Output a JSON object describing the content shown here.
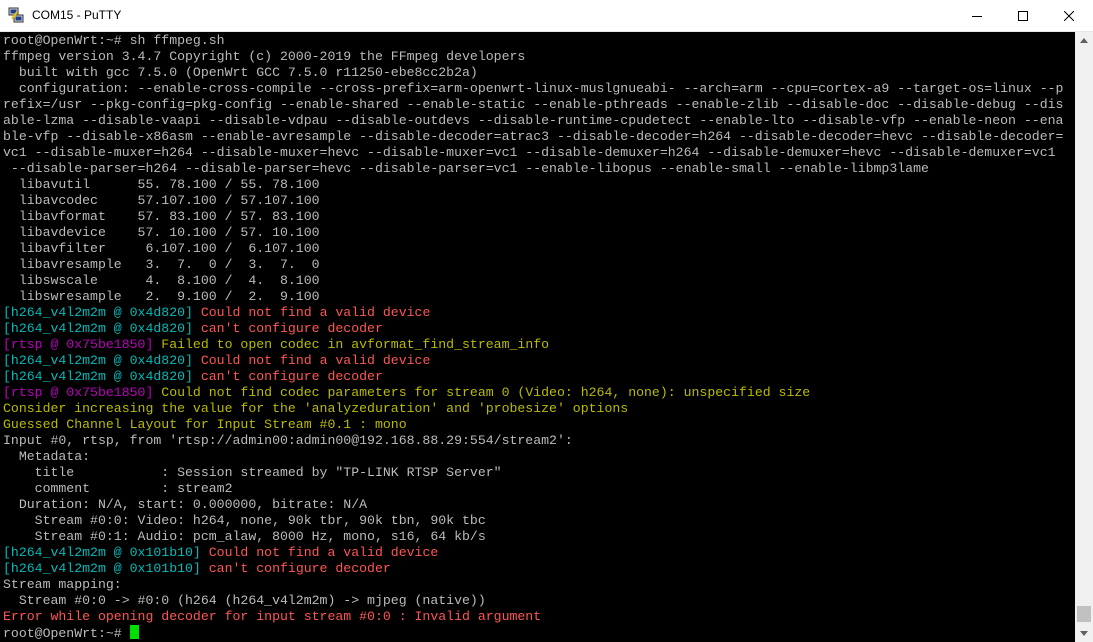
{
  "window": {
    "title": "COM15 - PuTTY",
    "icons": {
      "app": "putty-icon",
      "minimize": "minimize-icon",
      "maximize": "maximize-icon",
      "close": "close-icon"
    }
  },
  "colors": {
    "default": "#bbbbbb",
    "cyan": "#00bbbb",
    "red": "#ff5555",
    "magenta": "#bb00bb",
    "yellow": "#bbbb00",
    "green_cursor": "#00e000"
  },
  "terminal": {
    "lines": [
      [
        {
          "t": "root@OpenWrt:~# sh ffmpeg.sh",
          "c": "default"
        }
      ],
      [
        {
          "t": "ffmpeg version 3.4.7 Copyright (c) 2000-2019 the FFmpeg developers",
          "c": "default"
        }
      ],
      [
        {
          "t": "  built with gcc 7.5.0 (OpenWrt GCC 7.5.0 r11250-ebe8cc2b2a)",
          "c": "default"
        }
      ],
      [
        {
          "t": "  configuration: --enable-cross-compile --cross-prefix=arm-openwrt-linux-muslgnueabi- --arch=arm --cpu=cortex-a9 --target-os=linux --p",
          "c": "default"
        }
      ],
      [
        {
          "t": "refix=/usr --pkg-config=pkg-config --enable-shared --enable-static --enable-pthreads --enable-zlib --disable-doc --disable-debug --dis",
          "c": "default"
        }
      ],
      [
        {
          "t": "able-lzma --disable-vaapi --disable-vdpau --disable-outdevs --disable-runtime-cpudetect --enable-lto --disable-vfp --enable-neon --ena",
          "c": "default"
        }
      ],
      [
        {
          "t": "ble-vfp --disable-x86asm --enable-avresample --disable-decoder=atrac3 --disable-decoder=h264 --disable-decoder=hevc --disable-decoder=",
          "c": "default"
        }
      ],
      [
        {
          "t": "vc1 --disable-muxer=h264 --disable-muxer=hevc --disable-muxer=vc1 --disable-demuxer=h264 --disable-demuxer=hevc --disable-demuxer=vc1",
          "c": "default"
        }
      ],
      [
        {
          "t": " --disable-parser=h264 --disable-parser=hevc --disable-parser=vc1 --enable-libopus --enable-small --enable-libmp3lame",
          "c": "default"
        }
      ],
      [
        {
          "t": "  libavutil      55. 78.100 / 55. 78.100",
          "c": "default"
        }
      ],
      [
        {
          "t": "  libavcodec     57.107.100 / 57.107.100",
          "c": "default"
        }
      ],
      [
        {
          "t": "  libavformat    57. 83.100 / 57. 83.100",
          "c": "default"
        }
      ],
      [
        {
          "t": "  libavdevice    57. 10.100 / 57. 10.100",
          "c": "default"
        }
      ],
      [
        {
          "t": "  libavfilter     6.107.100 /  6.107.100",
          "c": "default"
        }
      ],
      [
        {
          "t": "  libavresample   3.  7.  0 /  3.  7.  0",
          "c": "default"
        }
      ],
      [
        {
          "t": "  libswscale      4.  8.100 /  4.  8.100",
          "c": "default"
        }
      ],
      [
        {
          "t": "  libswresample   2.  9.100 /  2.  9.100",
          "c": "default"
        }
      ],
      [
        {
          "t": "[h264_v4l2m2m @ 0x4d820] ",
          "c": "cyan"
        },
        {
          "t": "Could not find a valid device",
          "c": "red"
        }
      ],
      [
        {
          "t": "[h264_v4l2m2m @ 0x4d820] ",
          "c": "cyan"
        },
        {
          "t": "can't configure decoder",
          "c": "red"
        }
      ],
      [
        {
          "t": "[rtsp @ 0x75be1850] ",
          "c": "magenta"
        },
        {
          "t": "Failed to open codec in avformat_find_stream_info",
          "c": "yellow"
        }
      ],
      [
        {
          "t": "[h264_v4l2m2m @ 0x4d820] ",
          "c": "cyan"
        },
        {
          "t": "Could not find a valid device",
          "c": "red"
        }
      ],
      [
        {
          "t": "[h264_v4l2m2m @ 0x4d820] ",
          "c": "cyan"
        },
        {
          "t": "can't configure decoder",
          "c": "red"
        }
      ],
      [
        {
          "t": "[rtsp @ 0x75be1850] ",
          "c": "magenta"
        },
        {
          "t": "Could not find codec parameters for stream 0 (Video: h264, none): unspecified size",
          "c": "yellow"
        }
      ],
      [
        {
          "t": "Consider increasing the value for the 'analyzeduration' and 'probesize' options",
          "c": "yellow"
        }
      ],
      [
        {
          "t": "Guessed Channel Layout for Input Stream #0.1 : mono",
          "c": "yellow"
        }
      ],
      [
        {
          "t": "Input #0, rtsp, from 'rtsp://admin00:admin00@192.168.88.29:554/stream2':",
          "c": "default"
        }
      ],
      [
        {
          "t": "  Metadata:",
          "c": "default"
        }
      ],
      [
        {
          "t": "    title           : Session streamed by \"TP-LINK RTSP Server\"",
          "c": "default"
        }
      ],
      [
        {
          "t": "    comment         : stream2",
          "c": "default"
        }
      ],
      [
        {
          "t": "  Duration: N/A, start: 0.000000, bitrate: N/A",
          "c": "default"
        }
      ],
      [
        {
          "t": "    Stream #0:0: Video: h264, none, 90k tbr, 90k tbn, 90k tbc",
          "c": "default"
        }
      ],
      [
        {
          "t": "    Stream #0:1: Audio: pcm_alaw, 8000 Hz, mono, s16, 64 kb/s",
          "c": "default"
        }
      ],
      [
        {
          "t": "[h264_v4l2m2m @ 0x101b10] ",
          "c": "cyan"
        },
        {
          "t": "Could not find a valid device",
          "c": "red"
        }
      ],
      [
        {
          "t": "[h264_v4l2m2m @ 0x101b10] ",
          "c": "cyan"
        },
        {
          "t": "can't configure decoder",
          "c": "red"
        }
      ],
      [
        {
          "t": "Stream mapping:",
          "c": "default"
        }
      ],
      [
        {
          "t": "  Stream #0:0 -> #0:0 (h264 (h264_v4l2m2m) -> mjpeg (native))",
          "c": "default"
        }
      ],
      [
        {
          "t": "Error while opening decoder for input stream #0:0 : Invalid argument",
          "c": "red"
        }
      ],
      [
        {
          "t": "root@OpenWrt:~# ",
          "c": "default"
        }
      ]
    ]
  }
}
